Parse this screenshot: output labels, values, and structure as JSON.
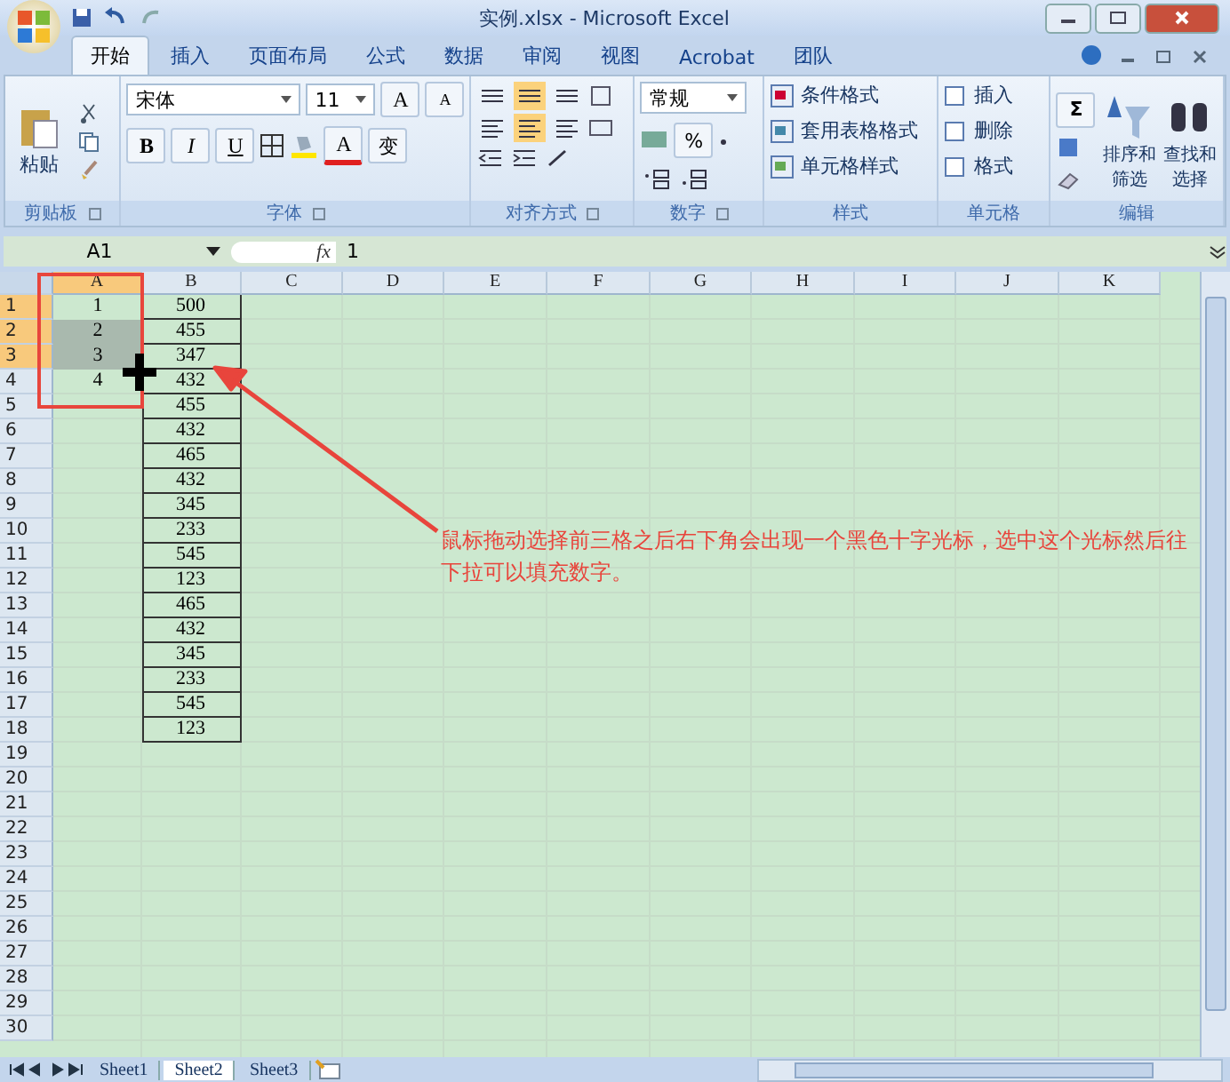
{
  "window": {
    "title": "实例.xlsx - Microsoft Excel"
  },
  "tabs": [
    {
      "label": "开始",
      "selected": true
    },
    {
      "label": "插入",
      "selected": false
    },
    {
      "label": "页面布局",
      "selected": false
    },
    {
      "label": "公式",
      "selected": false
    },
    {
      "label": "数据",
      "selected": false
    },
    {
      "label": "审阅",
      "selected": false
    },
    {
      "label": "视图",
      "selected": false
    },
    {
      "label": "Acrobat",
      "selected": false
    },
    {
      "label": "团队",
      "selected": false
    }
  ],
  "ribbon": {
    "clipboard": {
      "paste": "粘贴",
      "label": "剪贴板"
    },
    "font": {
      "name": "宋体",
      "size": "11",
      "grow": "A",
      "shrink": "A",
      "bold": "B",
      "italic": "I",
      "underline": "U",
      "color_button": "A",
      "phonetic": "变",
      "label": "字体"
    },
    "alignment": {
      "label": "对齐方式"
    },
    "number": {
      "format": "常规",
      "percent": "%",
      "label": "数字"
    },
    "styles": {
      "items": [
        "条件格式",
        "套用表格格式",
        "单元格样式"
      ],
      "label": "样式"
    },
    "cells": {
      "items": [
        "插入",
        "删除",
        "格式"
      ],
      "label": "单元格"
    },
    "editing": {
      "sum": "Σ",
      "sort": [
        "排序和",
        "筛选"
      ],
      "find": [
        "查找和",
        "选择"
      ],
      "label": "编辑"
    }
  },
  "formula_bar": {
    "name_box": "A1",
    "fx": "fx",
    "value": "1"
  },
  "columns": [
    {
      "label": "A",
      "selected": true
    },
    {
      "label": "B",
      "selected": false
    },
    {
      "label": "C",
      "selected": false
    },
    {
      "label": "D",
      "selected": false
    },
    {
      "label": "E",
      "selected": false
    },
    {
      "label": "F",
      "selected": false
    },
    {
      "label": "G",
      "selected": false
    },
    {
      "label": "H",
      "selected": false
    },
    {
      "label": "I",
      "selected": false
    },
    {
      "label": "J",
      "selected": false
    },
    {
      "label": "K",
      "selected": false
    }
  ],
  "rows": [
    {
      "label": "1",
      "selected": true,
      "a": {
        "text": "1",
        "selected": true
      },
      "b": "500"
    },
    {
      "label": "2",
      "selected": true,
      "a": {
        "text": "2",
        "selected": true
      },
      "b": "455"
    },
    {
      "label": "3",
      "selected": true,
      "a": {
        "text": "3",
        "selected": true
      },
      "b": "347"
    },
    {
      "label": "4",
      "selected": false,
      "a": {
        "text": "4",
        "selected": false
      },
      "b": "432"
    },
    {
      "label": "5",
      "selected": false,
      "b": "455"
    },
    {
      "label": "6",
      "selected": false,
      "b": "432"
    },
    {
      "label": "7",
      "selected": false,
      "b": "465"
    },
    {
      "label": "8",
      "selected": false,
      "b": "432"
    },
    {
      "label": "9",
      "selected": false,
      "b": "345"
    },
    {
      "label": "10",
      "selected": false,
      "b": "233"
    },
    {
      "label": "11",
      "selected": false,
      "b": "545"
    },
    {
      "label": "12",
      "selected": false,
      "b": "123"
    },
    {
      "label": "13",
      "selected": false,
      "b": "465"
    },
    {
      "label": "14",
      "selected": false,
      "b": "432"
    },
    {
      "label": "15",
      "selected": false,
      "b": "345"
    },
    {
      "label": "16",
      "selected": false,
      "b": "233"
    },
    {
      "label": "17",
      "selected": false,
      "b": "545"
    },
    {
      "label": "18",
      "selected": false,
      "b": "123"
    },
    {
      "label": "19",
      "selected": false
    },
    {
      "label": "20",
      "selected": false
    },
    {
      "label": "21",
      "selected": false
    },
    {
      "label": "22",
      "selected": false
    },
    {
      "label": "23",
      "selected": false
    },
    {
      "label": "24",
      "selected": false
    },
    {
      "label": "25",
      "selected": false
    },
    {
      "label": "26",
      "selected": false
    },
    {
      "label": "27",
      "selected": false
    },
    {
      "label": "28",
      "selected": false
    },
    {
      "label": "29",
      "selected": false
    },
    {
      "label": "30",
      "selected": false
    }
  ],
  "annotation": "鼠标拖动选择前三格之后右下角会出现一个黑色十字光标，选中这个光标然后往下拉可以填充数字。",
  "sheet_tabs": [
    {
      "label": "Sheet1",
      "selected": false
    },
    {
      "label": "Sheet2",
      "selected": true
    },
    {
      "label": "Sheet3",
      "selected": false
    }
  ]
}
